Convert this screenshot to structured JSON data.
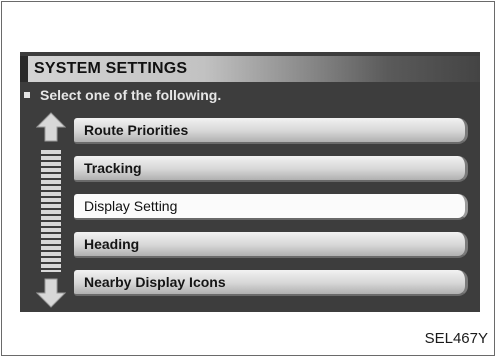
{
  "screen": {
    "title": "SYSTEM SETTINGS",
    "instruction": "Select one of the following.",
    "menu_items": [
      {
        "label": "Route Priorities",
        "selected": false
      },
      {
        "label": "Tracking",
        "selected": false
      },
      {
        "label": "Display Setting",
        "selected": true
      },
      {
        "label": "Heading",
        "selected": false
      },
      {
        "label": "Nearby Display Icons",
        "selected": false
      }
    ],
    "icons": {
      "scroll_up": "arrow-up-icon",
      "scroll_down": "arrow-down-icon"
    }
  },
  "figure_code": "SEL467Y",
  "colors": {
    "screen_background": "#3d3d3d",
    "button_highlight": "#fbfbfb",
    "text_light": "#e6e6e6"
  }
}
